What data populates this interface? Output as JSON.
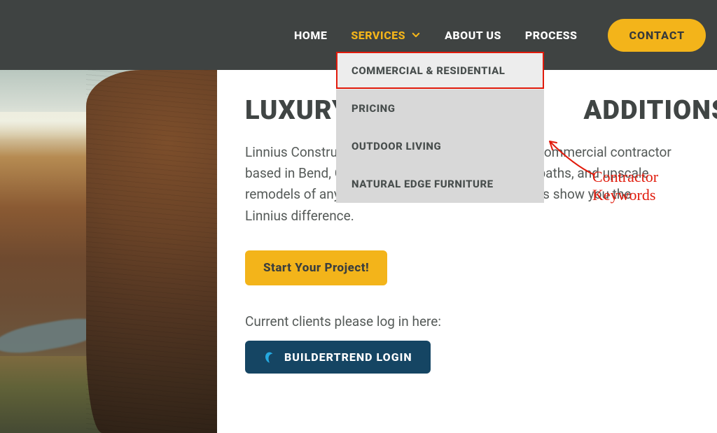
{
  "nav": {
    "items": [
      {
        "label": "HOME"
      },
      {
        "label": "SERVICES"
      },
      {
        "label": "ABOUT US"
      },
      {
        "label": "PROCESS"
      }
    ],
    "contact_label": "CONTACT"
  },
  "dropdown": {
    "items": [
      {
        "label": "COMMERCIAL & RESIDENTIAL"
      },
      {
        "label": "PRICING"
      },
      {
        "label": "OUTDOOR LIVING"
      },
      {
        "label": "NATURAL EDGE FURNITURE"
      }
    ]
  },
  "annotation": {
    "text": "Contractor Keywords"
  },
  "hero": {
    "heading_visible": "LUXURY                                ADDITIONS IN CENT",
    "lead": "Linnius Construction is a licensed residential and commercial contractor based in Bend, Oregon. We specialize in kitchens, baths, and upscale remodels of any kind. Give us a call today and let us show you the Linnius difference.",
    "cta_label": "Start Your Project!",
    "login_note": "Current clients please log in here:",
    "login_button_label": "BUILDERTREND LOGIN"
  },
  "colors": {
    "accent": "#f3b41a",
    "nav_bg": "#3f4342",
    "login_bg": "#154563",
    "annotation_red": "#e11b0c"
  }
}
